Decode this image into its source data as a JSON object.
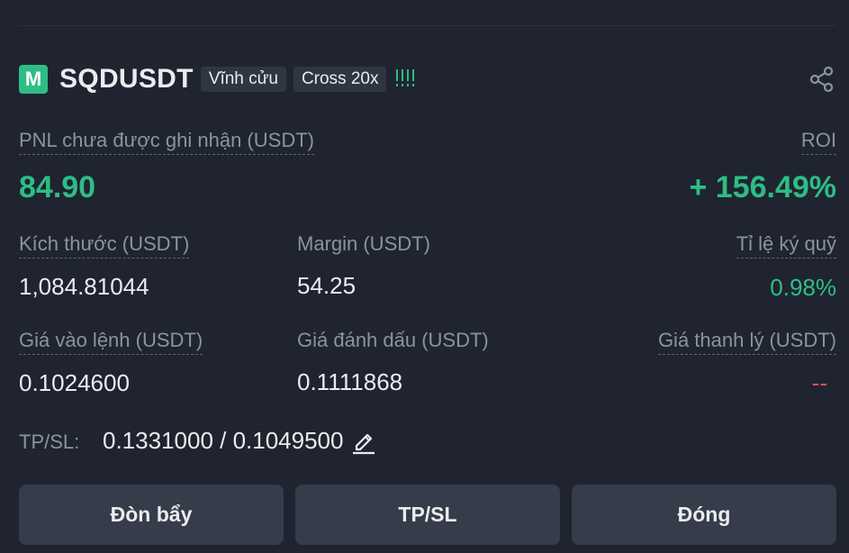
{
  "position": {
    "coin_icon_letter": "M",
    "symbol": "SQDUSDT",
    "contract_type": "Vĩnh cửu",
    "margin_mode": "Cross 20x",
    "risk_indicator": "!!!!"
  },
  "pnl": {
    "label": "PNL chưa được ghi nhận (USDT)",
    "value": "84.90",
    "roi_label": "ROI",
    "roi_value": "+ 156.49%"
  },
  "stats_row1": {
    "size_label": "Kích thước (USDT)",
    "size_value": "1,084.81044",
    "margin_label": "Margin (USDT)",
    "margin_value": "54.25",
    "margin_ratio_label": "Tỉ lệ ký quỹ",
    "margin_ratio_value": "0.98%"
  },
  "stats_row2": {
    "entry_label": "Giá vào lệnh (USDT)",
    "entry_value": "0.1024600",
    "mark_label": "Giá đánh dấu (USDT)",
    "mark_value": "0.1111868",
    "liq_label": "Giá thanh lý (USDT)",
    "liq_value": "--"
  },
  "tpsl": {
    "label": "TP/SL:",
    "value": "0.1331000 / 0.1049500"
  },
  "buttons": {
    "leverage": "Đòn bẩy",
    "tpsl": "TP/SL",
    "close": "Đóng"
  },
  "colors": {
    "background": "#1f2430",
    "profit_green": "#2ebd85",
    "loss_red": "#d9525f",
    "button_bg": "#363c49"
  },
  "icons": {
    "share": "share-icon",
    "edit": "pencil-edit-icon"
  }
}
